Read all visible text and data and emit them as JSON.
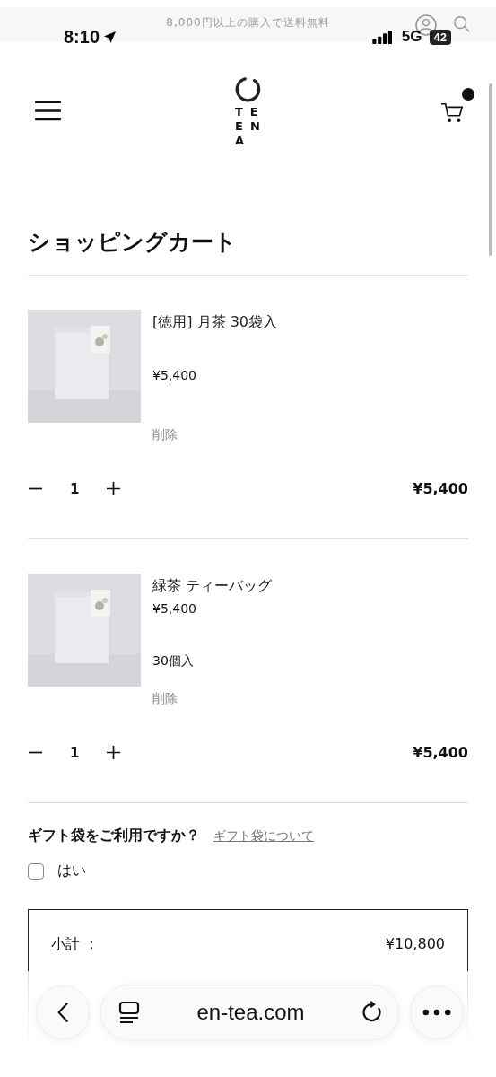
{
  "announcement": "8,000円以上の購入で送料無料",
  "status_bar": {
    "time": "8:10",
    "network": "5G",
    "battery": "42"
  },
  "logo": {
    "lines": [
      "TE",
      "EN",
      "A"
    ]
  },
  "cart_badge": true,
  "title": "ショッピングカート",
  "items": [
    {
      "name": "[徳用] 月茶 30袋入",
      "price": "¥5,400",
      "remove": "削除",
      "quantity": "1",
      "total": "¥5,400"
    },
    {
      "name": "緑茶 ティーバッグ",
      "price": "¥5,400",
      "variant": "30個入",
      "remove": "削除",
      "quantity": "1",
      "total": "¥5,400"
    }
  ],
  "gift": {
    "question": "ギフト袋をご利用ですか？",
    "link": "ギフト袋について",
    "option": "はい",
    "checked": false
  },
  "summary": [
    {
      "label": "小計 ：",
      "value": "¥10,800"
    }
  ],
  "browser": {
    "url": "en-tea.com"
  }
}
